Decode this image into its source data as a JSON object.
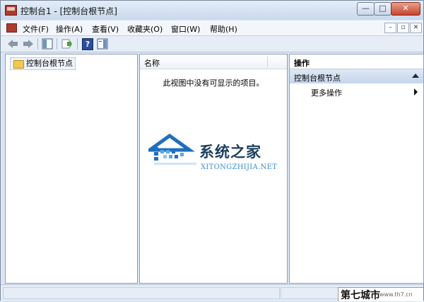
{
  "window": {
    "title": "控制台1 - [控制台根节点]",
    "buttons": {
      "minimize": "—",
      "maximize": "□",
      "close": "✕"
    }
  },
  "menu": {
    "items": [
      "文件(F)",
      "操作(A)",
      "查看(V)",
      "收藏夹(O)",
      "窗口(W)",
      "帮助(H)"
    ],
    "child_buttons": {
      "minimize": "–",
      "restore": "▫",
      "close": "✕"
    }
  },
  "toolbar": {
    "icons": [
      "back-arrow-icon",
      "forward-arrow-icon",
      "show-hide-tree-icon",
      "export-list-icon",
      "help-icon",
      "show-hide-action-pane-icon"
    ],
    "help_label": "?"
  },
  "tree": {
    "root_label": "控制台根节点"
  },
  "list": {
    "column_header": "名称",
    "empty_message": "此视图中没有可显示的项目。"
  },
  "actions": {
    "header": "操作",
    "section_title": "控制台根节点",
    "more_actions": "更多操作"
  },
  "watermark": {
    "name": "系统之家",
    "url": "XITONGZHIJIA.NET"
  },
  "badge": {
    "name": "第七城市",
    "url": "www.th7.cn"
  },
  "colors": {
    "accent": "#1e6fbf",
    "close_red": "#c7442c",
    "chrome": "#dbe6f3"
  }
}
